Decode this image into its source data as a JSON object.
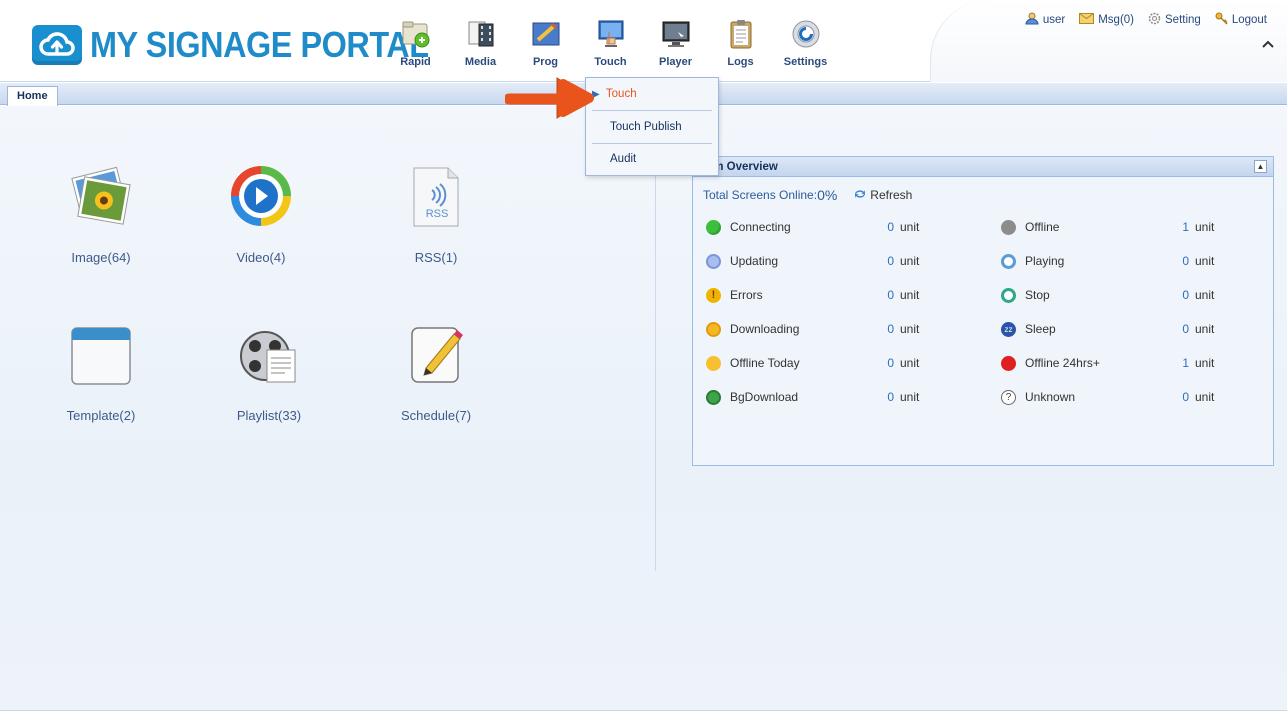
{
  "app": {
    "logo_text": "MY SIGNAGE PORTAL",
    "brand_color": "#1f8bc9"
  },
  "nav": {
    "items": [
      {
        "label": "Rapid",
        "icon": "rapid-icon"
      },
      {
        "label": "Media",
        "icon": "media-icon"
      },
      {
        "label": "Prog",
        "icon": "program-icon"
      },
      {
        "label": "Touch",
        "icon": "touch-icon"
      },
      {
        "label": "Player",
        "icon": "player-icon"
      },
      {
        "label": "Logs",
        "icon": "logs-icon"
      },
      {
        "label": "Settings",
        "icon": "settings-icon"
      }
    ]
  },
  "top_links": {
    "user": "user",
    "msg": "Msg(0)",
    "setting": "Setting",
    "logout": "Logout"
  },
  "tabs": {
    "home": "Home"
  },
  "dropdown": {
    "items": [
      "Touch",
      "Touch Publish",
      "Audit"
    ],
    "active_color": "#e8541c"
  },
  "tiles": [
    {
      "label": "Image(64)",
      "icon": "image-icon"
    },
    {
      "label": "Video(4)",
      "icon": "video-icon"
    },
    {
      "label": "RSS(1)",
      "icon": "rss-icon",
      "icon_text": "RSS"
    },
    {
      "label": "Template(2)",
      "icon": "template-icon"
    },
    {
      "label": "Playlist(33)",
      "icon": "playlist-icon"
    },
    {
      "label": "Schedule(7)",
      "icon": "schedule-icon"
    }
  ],
  "overview": {
    "title": "tem Overview",
    "online_label": "Total Screens Online:",
    "online_pct": "0%",
    "refresh": "Refresh",
    "unit": "unit",
    "left": [
      {
        "name": "Connecting",
        "value": "0",
        "color": "#3cbf3c"
      },
      {
        "name": "Updating",
        "value": "0",
        "color": "#8fa7e0"
      },
      {
        "name": "Errors",
        "value": "0",
        "color": "#f0b400"
      },
      {
        "name": "Downloading",
        "value": "0",
        "color": "#f5b820"
      },
      {
        "name": "Offline Today",
        "value": "0",
        "color": "#f7c030"
      },
      {
        "name": "BgDownload",
        "value": "0",
        "color": "#3ea44a"
      }
    ],
    "right": [
      {
        "name": "Offline",
        "value": "1",
        "color": "#8c8c8c"
      },
      {
        "name": "Playing",
        "value": "0",
        "color": "#5b9bd8"
      },
      {
        "name": "Stop",
        "value": "0",
        "color": "#2ea88a"
      },
      {
        "name": "Sleep",
        "value": "0",
        "color": "#2a55a8"
      },
      {
        "name": "Offline 24hrs+",
        "value": "1",
        "color": "#e02020"
      },
      {
        "name": "Unknown",
        "value": "0",
        "color": "#ffffff"
      }
    ]
  }
}
